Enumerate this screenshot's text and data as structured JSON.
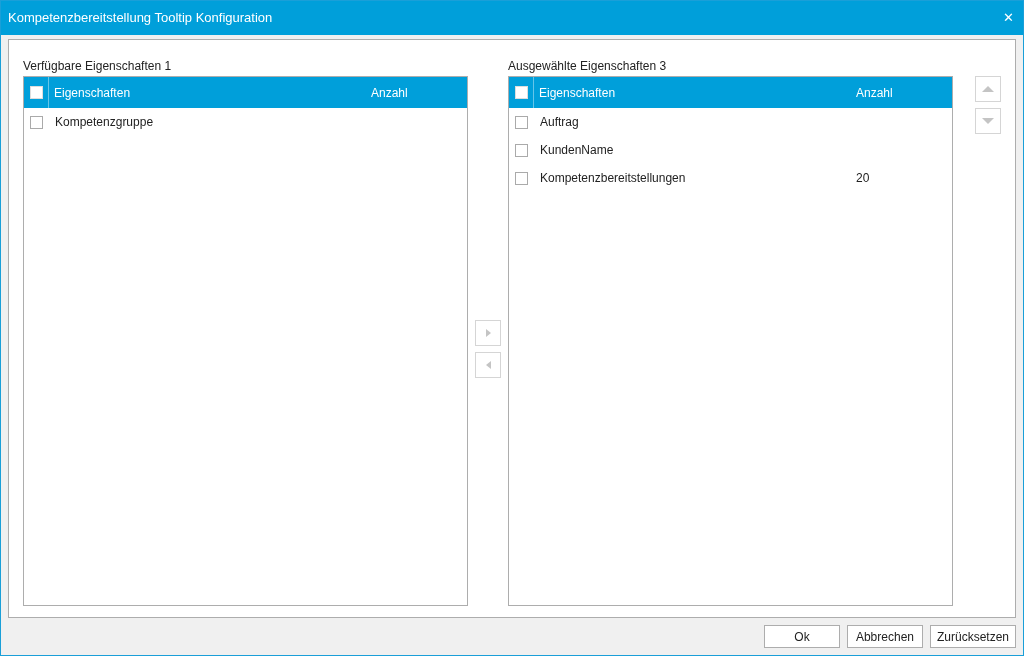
{
  "window": {
    "title": "Kompetenzbereitstellung Tooltip Konfiguration",
    "close": "✕"
  },
  "available": {
    "label": "Verfügbare Eigenschaften 1",
    "header": {
      "checked": false,
      "columns": [
        "Eigenschaften",
        "Anzahl"
      ]
    },
    "rows": [
      {
        "name": "Kompetenzgruppe",
        "checked": false
      }
    ]
  },
  "transfer_buttons": [
    {
      "kind": "right",
      "disabled": true
    },
    {
      "kind": "left",
      "disabled": true
    }
  ],
  "selected": {
    "label": "Ausgewählte Eigenschaften 3",
    "header": {
      "checked": false,
      "columns": [
        "Eigenschaften",
        "Anzahl"
      ]
    },
    "rows": [
      {
        "name": "Auftrag",
        "checked": false
      },
      {
        "name": "KundenName",
        "checked": false
      },
      {
        "name": "Kompetenzbereitstellungen",
        "count": "20",
        "checked": false
      }
    ]
  },
  "order_buttons": [
    {
      "kind": "up",
      "disabled": true
    },
    {
      "kind": "down",
      "disabled": true
    }
  ],
  "buttons": [
    "Ok",
    "Abbrechen",
    "Zurücksetzen"
  ]
}
